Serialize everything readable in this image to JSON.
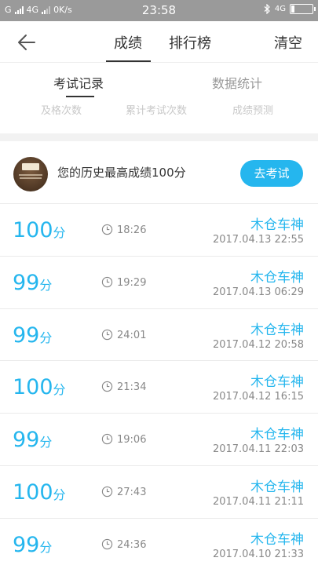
{
  "status_bar": {
    "carrier": "G",
    "network": "4G",
    "speed": "0K/s",
    "time": "23:58",
    "right_network": "4G",
    "battery_level": 0.15
  },
  "header": {
    "back_icon": "back-arrow-icon",
    "tabs": [
      {
        "label": "成绩",
        "active": true
      },
      {
        "label": "排行榜",
        "active": false
      }
    ],
    "clear_label": "清空"
  },
  "subtabs": [
    {
      "label": "考试记录",
      "active": true
    },
    {
      "label": "数据统计",
      "active": false
    }
  ],
  "stat_labels": [
    "及格次数",
    "累计考试次数",
    "成绩预测"
  ],
  "best": {
    "text": "您的历史最高成绩100分",
    "button_label": "去考试"
  },
  "records": [
    {
      "score": "100",
      "unit": "分",
      "duration": "18:26",
      "name": "木仓车神",
      "date": "2017.04.13  22:55"
    },
    {
      "score": "99",
      "unit": "分",
      "duration": "19:29",
      "name": "木仓车神",
      "date": "2017.04.13  06:29"
    },
    {
      "score": "99",
      "unit": "分",
      "duration": "24:01",
      "name": "木仓车神",
      "date": "2017.04.12  20:58"
    },
    {
      "score": "100",
      "unit": "分",
      "duration": "21:34",
      "name": "木仓车神",
      "date": "2017.04.12  16:15"
    },
    {
      "score": "99",
      "unit": "分",
      "duration": "19:06",
      "name": "木仓车神",
      "date": "2017.04.11  22:03"
    },
    {
      "score": "100",
      "unit": "分",
      "duration": "27:43",
      "name": "木仓车神",
      "date": "2017.04.11  21:11"
    },
    {
      "score": "99",
      "unit": "分",
      "duration": "24:36",
      "name": "木仓车神",
      "date": "2017.04.10  21:33"
    }
  ],
  "colors": {
    "accent": "#25b6ee",
    "status_bar": "#9a9a9a"
  }
}
